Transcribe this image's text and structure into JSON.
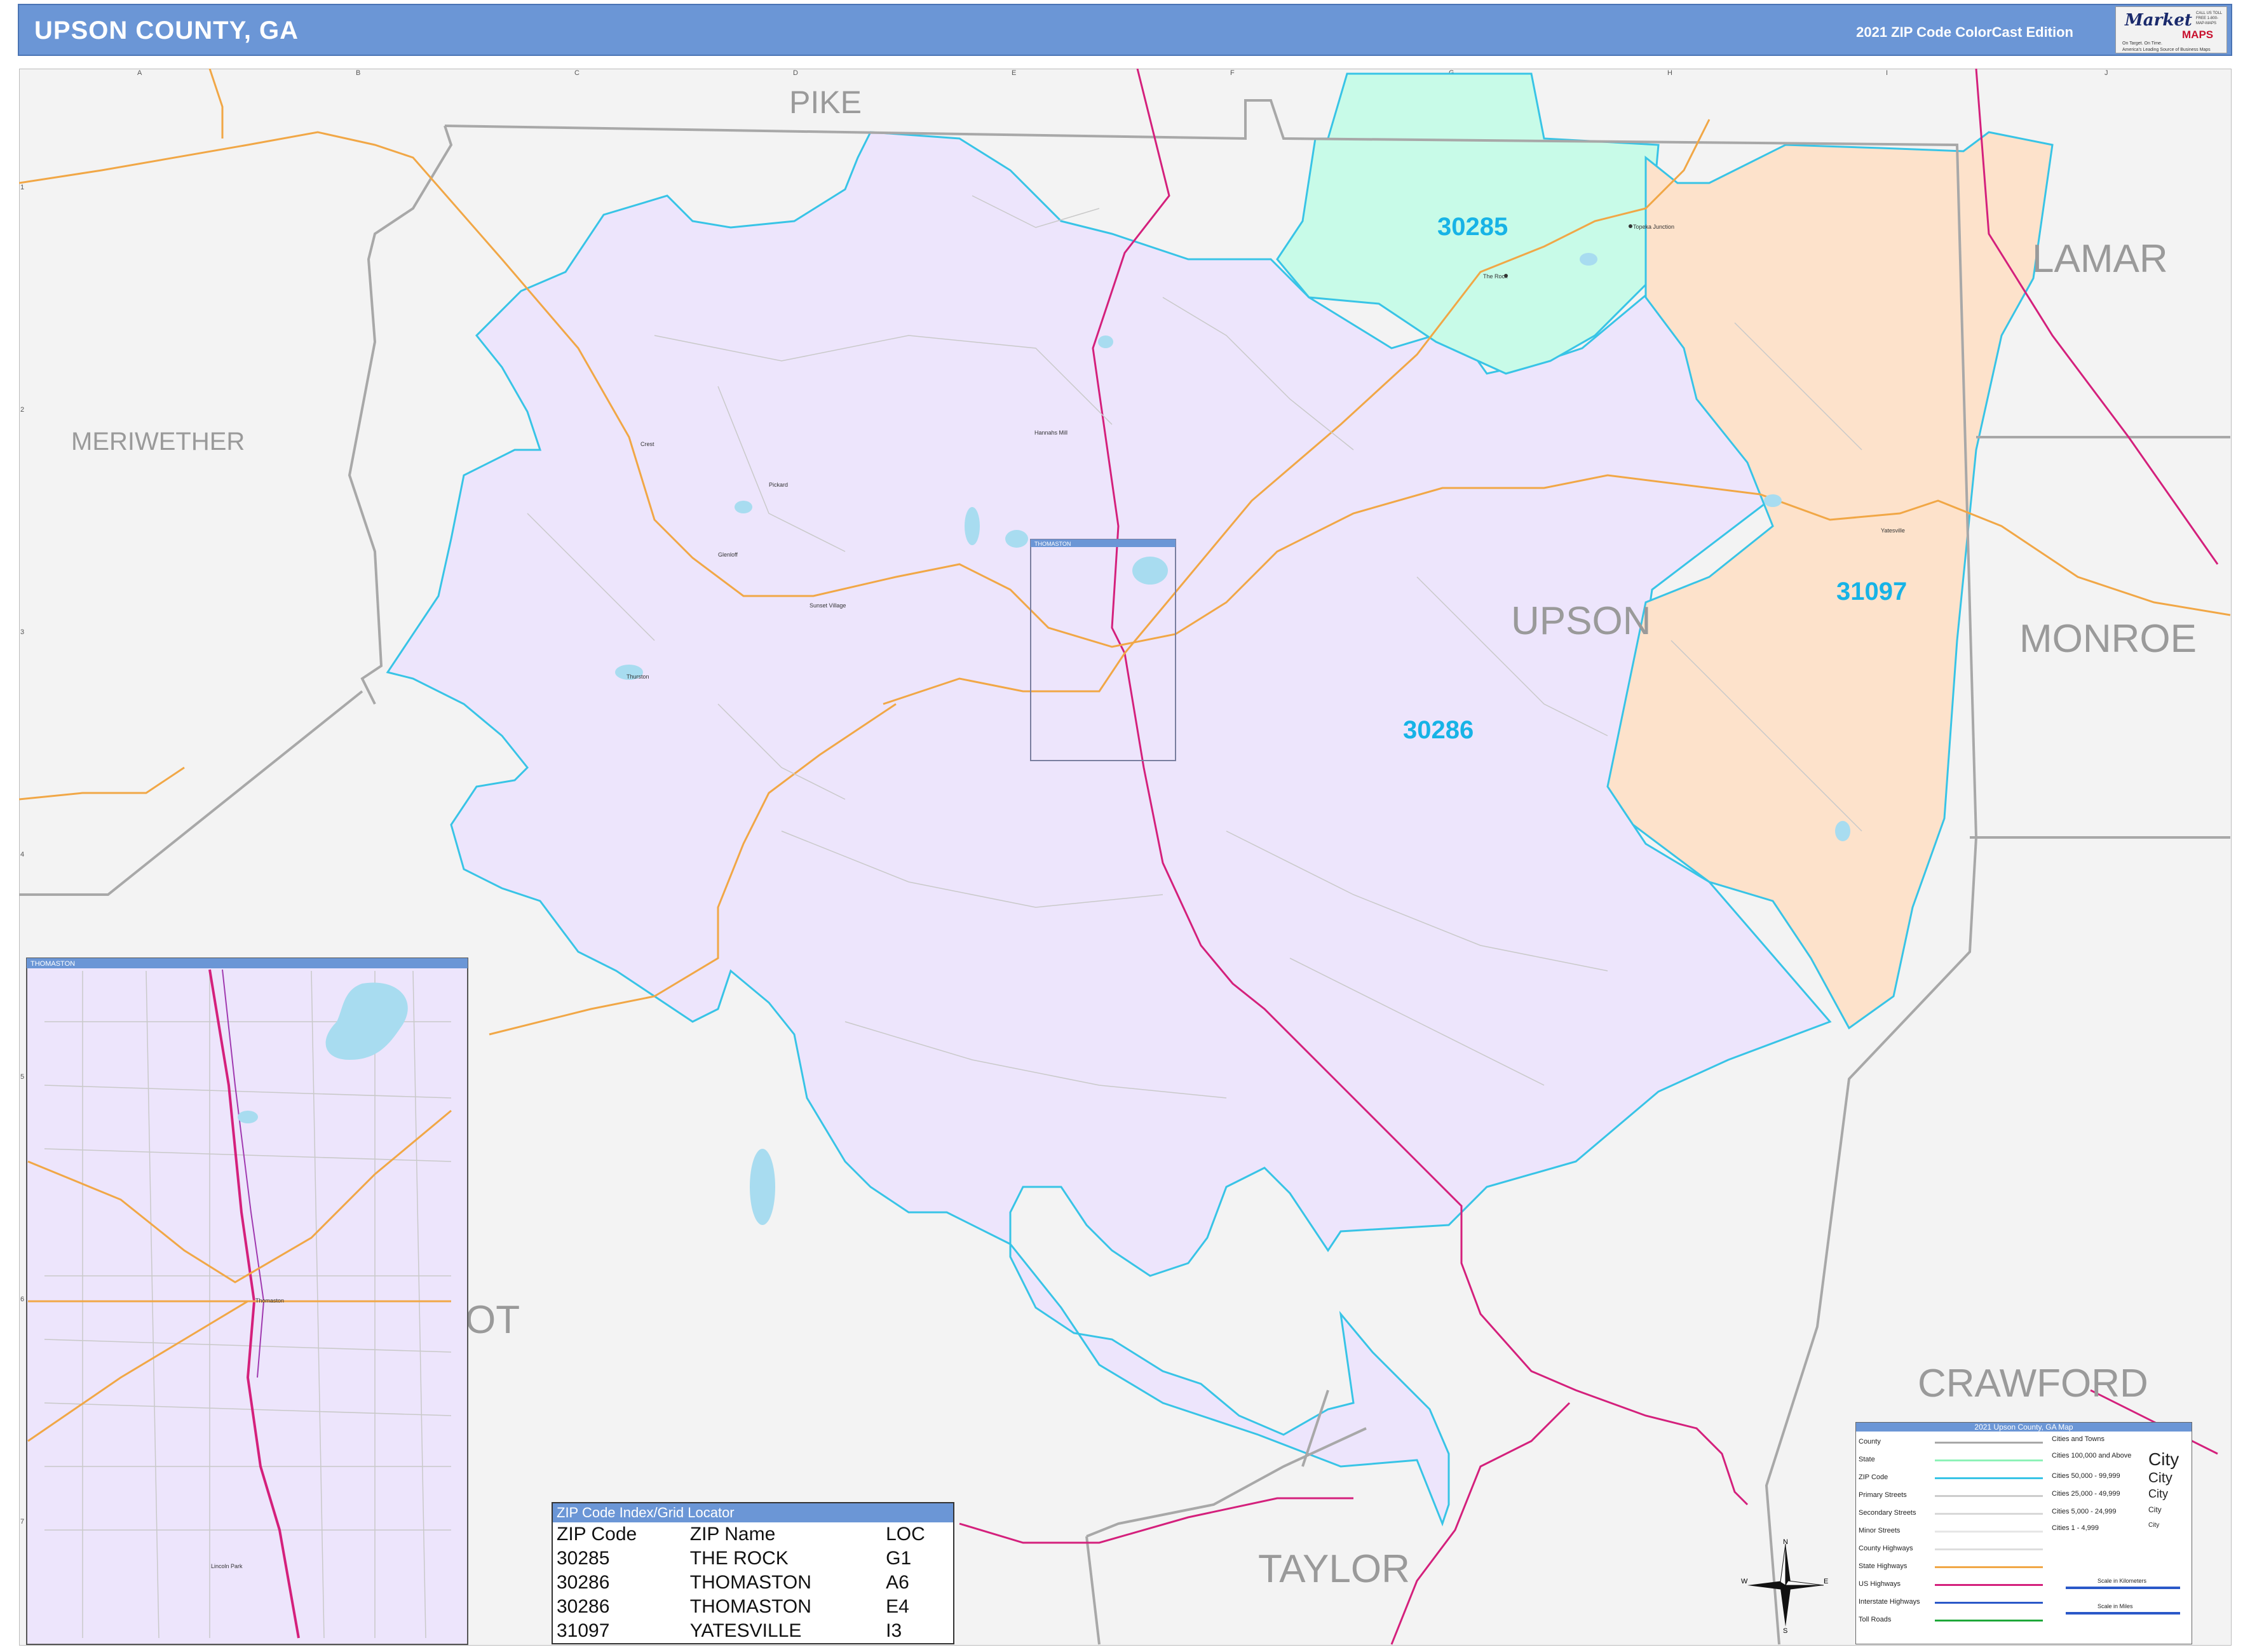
{
  "header": {
    "title": "UPSON COUNTY, GA",
    "edition": "2021 ZIP Code ColorCast Edition"
  },
  "logo": {
    "market": "Market",
    "maps": "MAPS",
    "tagline1": "On Target. On Time.",
    "tagline2": "America's Leading Source of Business Maps",
    "contact": "CALL US TOLL FREE 1-800-MAP-MAPS"
  },
  "colors": {
    "zip_30286": "#ede5fc",
    "zip_30285": "#c8fbe8",
    "zip_31097": "#fde2cb",
    "outside": "#f3f3f3",
    "zip_border": "#38c4e6",
    "county_border": "#a8a8a8",
    "us_highway": "#d4207c",
    "state_highway": "#f1a746",
    "header": "#6b96d6"
  },
  "counties": {
    "pike": "PIKE",
    "lamar": "LAMAR",
    "meriwether": "MERIWETHER",
    "upson": "UPSON",
    "monroe": "MONROE",
    "crawford": "CRAWFORD",
    "taylor": "TAYLOR",
    "talbot_partial": "OT"
  },
  "zip_labels": {
    "z30285": "30285",
    "z30286": "30286",
    "z31097": "31097"
  },
  "towns": {
    "topeka_junction": "Topeka Junction",
    "the_rock": "The Rock",
    "hannahs_mill": "Hannahs Mill",
    "crest": "Crest",
    "pickard": "Pickard",
    "glenloff": "Glenloff",
    "sunset_village": "Sunset Village",
    "thurston": "Thurston",
    "yatesville": "Yatesville",
    "thomaston": "Thomaston",
    "lincoln_park": "Lincoln Park"
  },
  "inset": {
    "title": "THOMASTON",
    "locator_label": "THOMASTON"
  },
  "grid": {
    "columns": [
      "A",
      "B",
      "C",
      "D",
      "E",
      "F",
      "G",
      "H",
      "I",
      "J"
    ],
    "rows": [
      "1",
      "2",
      "3",
      "4",
      "5",
      "6",
      "7"
    ]
  },
  "zip_index": {
    "title": "ZIP Code Index/Grid Locator",
    "headers": [
      "ZIP Code",
      "ZIP Name",
      "LOC"
    ],
    "rows": [
      [
        "30285",
        "THE ROCK",
        "G1"
      ],
      [
        "30286",
        "THOMASTON",
        "A6"
      ],
      [
        "30286",
        "THOMASTON",
        "E4"
      ],
      [
        "31097",
        "YATESVILLE",
        "I3"
      ]
    ]
  },
  "legend": {
    "title": "2021 Upson County, GA Map",
    "lines": [
      "County",
      "State",
      "ZIP Code",
      "Primary Streets",
      "Secondary Streets",
      "Minor Streets",
      "County Highways",
      "State Highways",
      "US Highways",
      "Interstate Highways",
      "Toll Roads"
    ],
    "cities_title": "Cities and Towns",
    "cities": [
      {
        "label": "Cities 100,000 and Above",
        "sample": "City"
      },
      {
        "label": "Cities 50,000 - 99,999",
        "sample": "City"
      },
      {
        "label": "Cities 25,000 - 49,999",
        "sample": "City"
      },
      {
        "label": "Cities 5,000 - 24,999",
        "sample": "City"
      },
      {
        "label": "Cities 1 - 4,999",
        "sample": "City"
      }
    ],
    "scale_km": "Scale in Kilometers",
    "scale_mi": "Scale in Miles"
  },
  "compass": {
    "n": "N",
    "s": "S",
    "e": "E",
    "w": "W"
  }
}
